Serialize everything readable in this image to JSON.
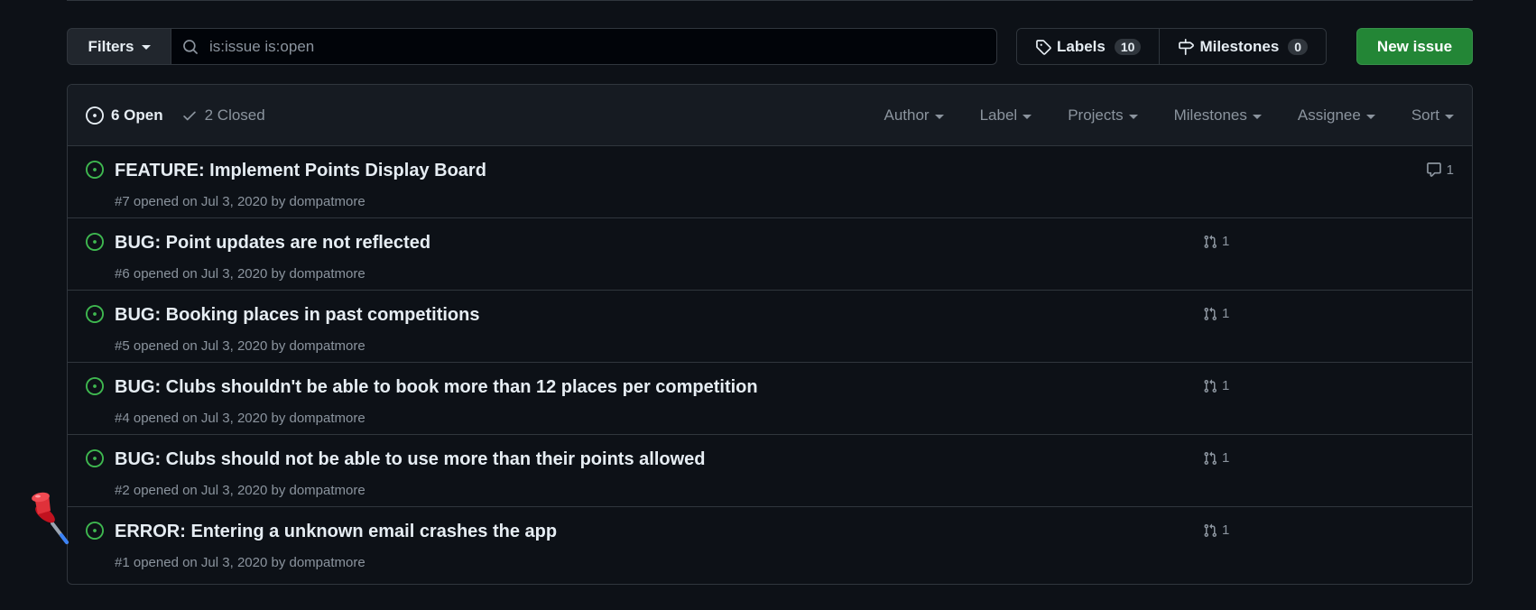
{
  "toolbar": {
    "filters_label": "Filters",
    "search_placeholder": "is:issue is:open",
    "search_value": "",
    "labels_label": "Labels",
    "labels_count": "10",
    "milestones_label": "Milestones",
    "milestones_count": "0",
    "new_issue_label": "New issue"
  },
  "header": {
    "open_label": "6 Open",
    "closed_label": "2 Closed",
    "filters": [
      "Author",
      "Label",
      "Projects",
      "Milestones",
      "Assignee",
      "Sort"
    ]
  },
  "issues": [
    {
      "title": "FEATURE: Implement Points Display Board",
      "meta": "#7 opened on Jul 3, 2020 by dompatmore",
      "comments": "1",
      "linked_prs": ""
    },
    {
      "title": "BUG: Point updates are not reflected",
      "meta": "#6 opened on Jul 3, 2020 by dompatmore",
      "comments": "",
      "linked_prs": "1"
    },
    {
      "title": "BUG: Booking places in past competitions",
      "meta": "#5 opened on Jul 3, 2020 by dompatmore",
      "comments": "",
      "linked_prs": "1"
    },
    {
      "title": "BUG: Clubs shouldn't be able to book more than 12 places per competition",
      "meta": "#4 opened on Jul 3, 2020 by dompatmore",
      "comments": "",
      "linked_prs": "1"
    },
    {
      "title": "BUG: Clubs should not be able to use more than their points allowed",
      "meta": "#2 opened on Jul 3, 2020 by dompatmore",
      "comments": "",
      "linked_prs": "1"
    },
    {
      "title": "ERROR: Entering a unknown email crashes the app",
      "meta": "#1 opened on Jul 3, 2020 by dompatmore",
      "comments": "",
      "linked_prs": "1"
    }
  ],
  "colors": {
    "background": "#0d1117",
    "header_bg": "#161b22",
    "border": "#30363d",
    "open_green": "#3fb950",
    "new_issue_green": "#238636",
    "muted_text": "#8b949e",
    "text": "#e6edf3",
    "pin_red": "#e0313a"
  },
  "icons": {
    "search": "search-icon",
    "tag": "tag-icon",
    "milestone": "milestone-icon",
    "issue_open": "issue-opened-icon",
    "check": "check-icon",
    "pull_request": "git-pull-request-icon",
    "comment": "comment-icon",
    "pin": "pushpin-icon"
  }
}
